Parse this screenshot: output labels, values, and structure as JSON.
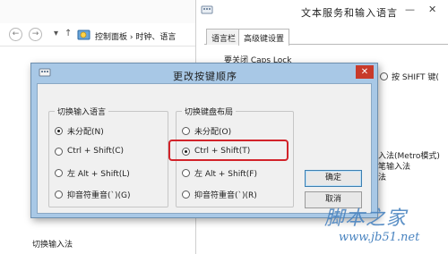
{
  "control_panel": {
    "back_icon": "←",
    "forward_icon": "→",
    "up_icon": "↑",
    "breadcrumb": "控制面板 › 时钟、语言",
    "bottom_label": "切换输入法"
  },
  "text_services": {
    "title": "文本服务和输入语言",
    "minimize": "—",
    "close": "✕",
    "tabs": [
      {
        "label": "语言栏"
      },
      {
        "label": "高级键设置"
      }
    ],
    "caps_lock_label": "要关闭 Caps Lock",
    "shift_option_label": "按 SHIFT 键(",
    "list_item_1": "入法(Metro模式)",
    "list_item_2": "笔输入法",
    "list_item_3": "法"
  },
  "dialog": {
    "title": "更改按键顺序",
    "close_label": "✕",
    "input_language_group": {
      "title": "切换输入语言",
      "options": [
        {
          "label": "未分配(N)",
          "selected": true
        },
        {
          "label": "Ctrl + Shift(C)",
          "selected": false
        },
        {
          "label": "左 Alt + Shift(L)",
          "selected": false
        },
        {
          "label": "抑音符重音(`)(G)",
          "selected": false
        }
      ]
    },
    "keyboard_layout_group": {
      "title": "切换键盘布局",
      "options": [
        {
          "label": "未分配(O)",
          "selected": false
        },
        {
          "label": "Ctrl + Shift(T)",
          "selected": true
        },
        {
          "label": "左 Alt + Shift(F)",
          "selected": false
        },
        {
          "label": "抑音符重音(`)(R)",
          "selected": false
        }
      ]
    },
    "ok_button": "确定",
    "cancel_button": "取消",
    "highlight_color": "#d2232a"
  },
  "watermark": {
    "site_name": "脚本之家",
    "url": "www.jb51.net"
  }
}
